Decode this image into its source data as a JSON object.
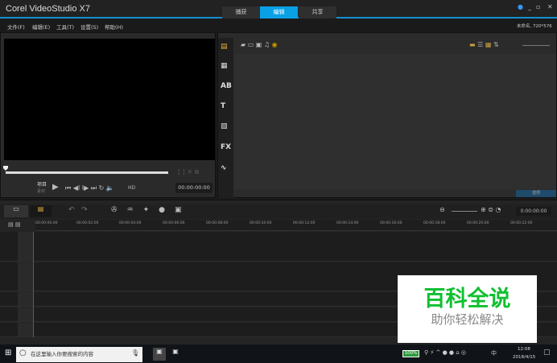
{
  "app": {
    "title": "Corel VideoStudio X7",
    "tabs": [
      {
        "label": "捕获"
      },
      {
        "label": "编辑",
        "active": true
      },
      {
        "label": "共享"
      }
    ],
    "accent": "#0aa0e6"
  },
  "menu": {
    "items": [
      "文件(F)",
      "编辑(E)",
      "工具(T)",
      "设置(S)",
      "帮助(H)"
    ],
    "project": "未命名, 720*576"
  },
  "player": {
    "mode_project": "项目",
    "mode_clip": "素材",
    "hd": "HD",
    "timecode": "00:00:00:00"
  },
  "library": {
    "side_icons": [
      "media-icon",
      "instant-project-icon",
      "transition-icon",
      "title-icon",
      "graphic-icon",
      "filter-icon",
      "path-icon"
    ],
    "options_label": "选项"
  },
  "timeline": {
    "timecode": "0:00:00:00",
    "ruler": [
      "00:00:00:00",
      "00:00:02:00",
      "00:00:04:00",
      "00:00:06:00",
      "00:00:08:00",
      "00:00:10:00",
      "00:00:12:00",
      "00:00:14:00",
      "00:00:16:00",
      "00:00:18:00",
      "00:00:20:00",
      "00:00:22:00"
    ]
  },
  "taskbar": {
    "search_placeholder": "在这里输入你要搜索的内容",
    "battery": "100%",
    "ime": "中",
    "time": "12:08",
    "date": "2018/4/15"
  },
  "watermark": {
    "title": "百科全说",
    "subtitle": "助你轻松解决"
  }
}
